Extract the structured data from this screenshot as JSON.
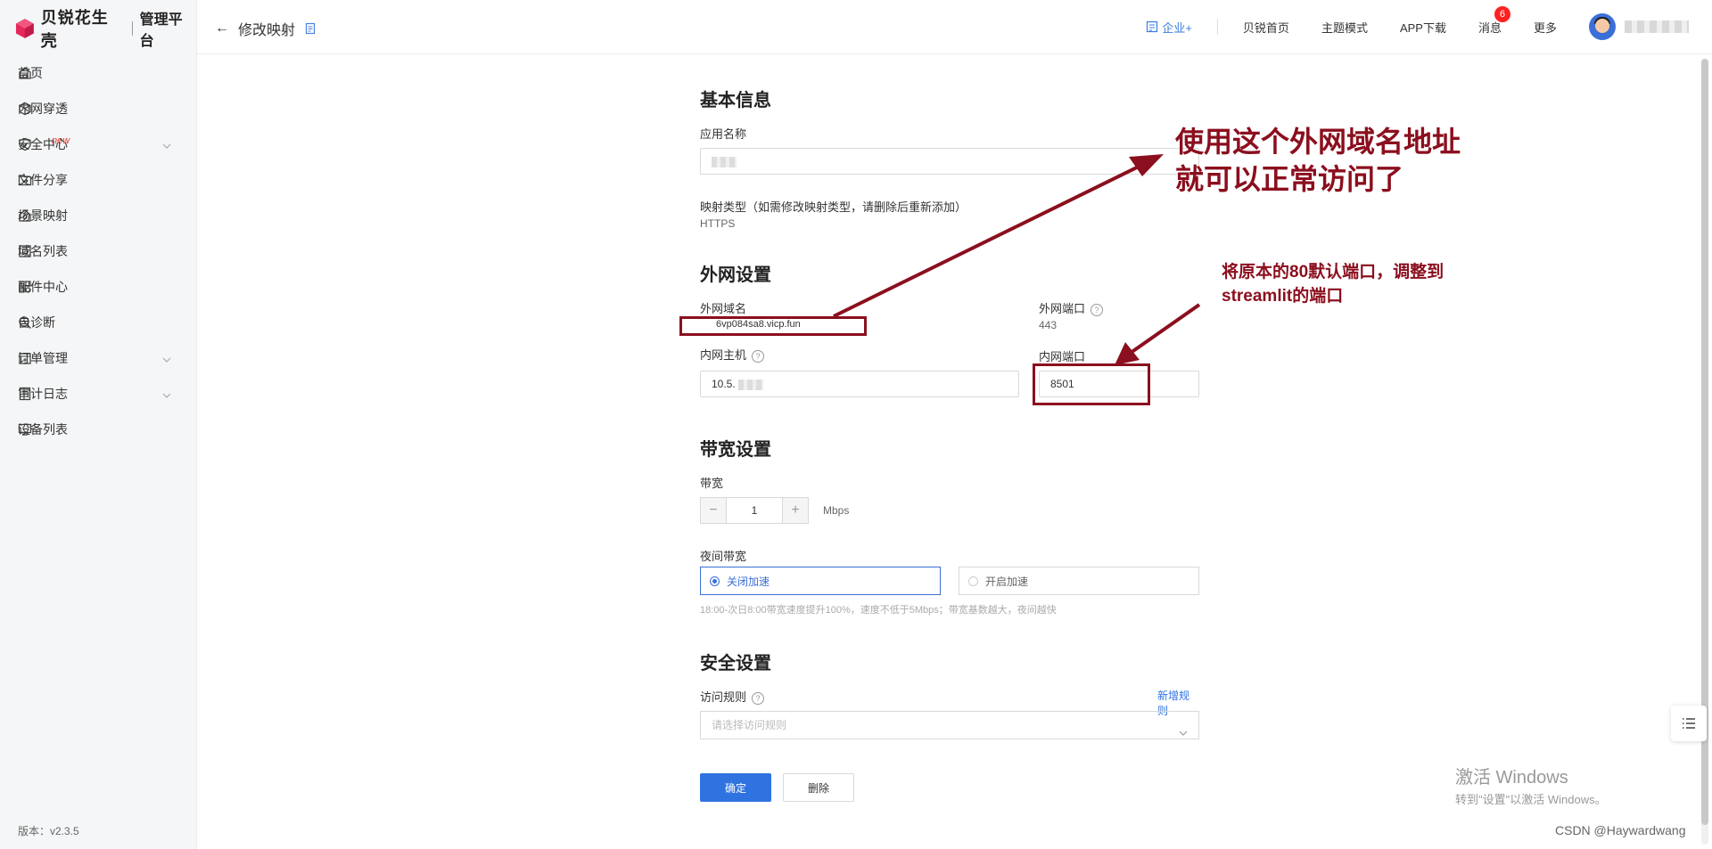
{
  "sidebar": {
    "logo_text": "贝锐花生壳",
    "logo_sub": "管理平台",
    "items": [
      {
        "label": "首页",
        "icon": "home-icon"
      },
      {
        "label": "内网穿透",
        "icon": "cube-icon"
      },
      {
        "label": "安全中心",
        "icon": "shield-icon",
        "tag": "new",
        "expandable": true
      },
      {
        "label": "文件分享",
        "icon": "folder-share-icon"
      },
      {
        "label": "场景映射",
        "icon": "scene-icon"
      },
      {
        "label": "域名列表",
        "icon": "domain-icon"
      },
      {
        "label": "配件中心",
        "icon": "grid-icon"
      },
      {
        "label": "自诊断",
        "icon": "diagnose-icon"
      },
      {
        "label": "订单管理",
        "icon": "order-icon",
        "expandable": true
      },
      {
        "label": "审计日志",
        "icon": "log-icon",
        "expandable": true
      },
      {
        "label": "设备列表",
        "icon": "monitor-icon"
      }
    ],
    "version": "版本：v2.3.5"
  },
  "header": {
    "back_title": "修改映射",
    "nav": {
      "enterprise": "企业+",
      "home": "贝锐首页",
      "theme": "主题模式",
      "app": "APP下载",
      "messages": "消息",
      "messages_badge": "6",
      "more": "更多"
    }
  },
  "form": {
    "basic": {
      "title": "基本信息",
      "app_name_label": "应用名称",
      "map_type_label": "映射类型（如需修改映射类型，请删除后重新添加）",
      "map_type_value": "HTTPS"
    },
    "external": {
      "title": "外网设置",
      "domain_label": "外网域名",
      "domain_value": "6vp084sa8.vicp.fun",
      "port_label": "外网端口",
      "port_value": "443",
      "host_label": "内网主机",
      "host_value": "10.5.",
      "inner_port_label": "内网端口",
      "inner_port_value": "8501"
    },
    "bandwidth": {
      "title": "带宽设置",
      "label": "带宽",
      "value": "1",
      "unit": "Mbps",
      "night_label": "夜间带宽",
      "option_off": "关闭加速",
      "option_on": "开启加速",
      "hint": "18:00-次日8:00带宽速度提升100%，速度不低于5Mbps；带宽基数越大，夜间越快"
    },
    "security": {
      "title": "安全设置",
      "rule_label": "访问规则",
      "add_rule": "新增规则",
      "rule_placeholder": "请选择访问规则"
    },
    "buttons": {
      "confirm": "确定",
      "delete": "删除"
    }
  },
  "annotations": {
    "big_line1": "使用这个外网域名地址",
    "big_line2": "就可以正常访问了",
    "small_line1": "将原本的80默认端口，调整到",
    "small_line2": "streamlit的端口"
  },
  "watermark": {
    "windows_line1": "激活 Windows",
    "windows_line2": "转到\"设置\"以激活 Windows。",
    "csdn": "CSDN @Haywardwang"
  },
  "colors": {
    "accent": "#2f73e0",
    "annotation": "#8b0f1e",
    "badge": "#ff2222"
  }
}
